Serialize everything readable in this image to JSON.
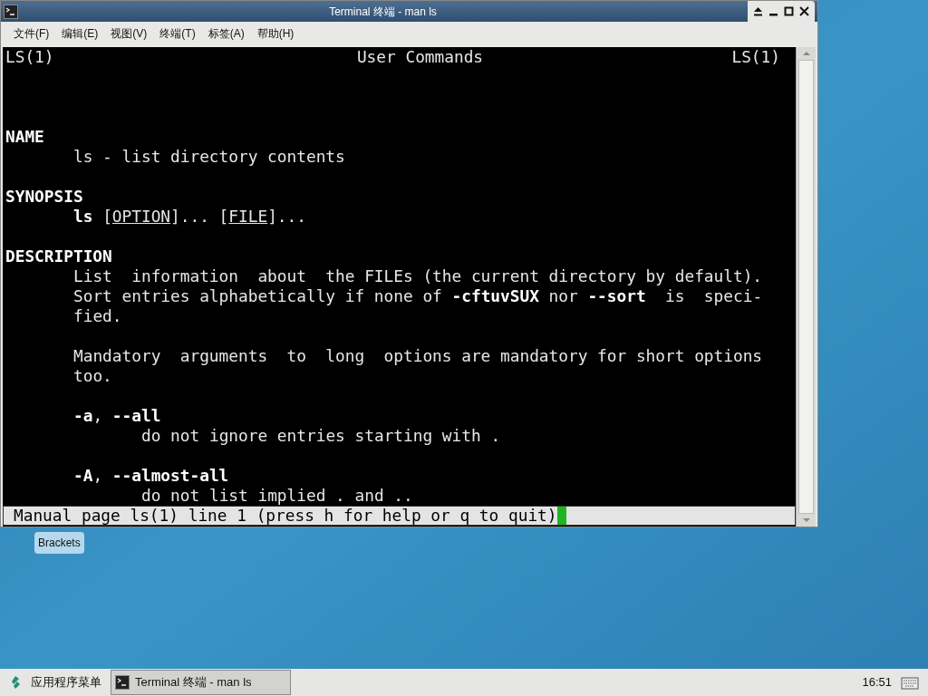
{
  "window": {
    "title": "Terminal 终端 - man ls"
  },
  "menu": [
    "文件(F)",
    "编辑(E)",
    "视图(V)",
    "终端(T)",
    "标签(A)",
    "帮助(H)"
  ],
  "terminal": {
    "header": {
      "left": "LS(1)",
      "center": "User Commands",
      "right": "LS(1)"
    },
    "lines": [
      {
        "kind": "blank"
      },
      {
        "kind": "blank"
      },
      {
        "kind": "blank"
      },
      {
        "kind": "heading",
        "segments": [
          {
            "text": "NAME",
            "kind": "bold"
          }
        ]
      },
      {
        "kind": "body",
        "segments": [
          {
            "text": "ls - list directory contents",
            "kind": "plain"
          }
        ]
      },
      {
        "kind": "blank"
      },
      {
        "kind": "heading",
        "segments": [
          {
            "text": "SYNOPSIS",
            "kind": "bold"
          }
        ]
      },
      {
        "kind": "body",
        "segments": [
          {
            "text": "ls",
            "kind": "bold"
          },
          {
            "text": " [",
            "kind": "plain"
          },
          {
            "text": "OPTION",
            "kind": "underline"
          },
          {
            "text": "]... [",
            "kind": "plain"
          },
          {
            "text": "FILE",
            "kind": "underline"
          },
          {
            "text": "]...",
            "kind": "plain"
          }
        ]
      },
      {
        "kind": "blank"
      },
      {
        "kind": "heading",
        "segments": [
          {
            "text": "DESCRIPTION",
            "kind": "bold"
          }
        ]
      },
      {
        "kind": "body",
        "segments": [
          {
            "text": "List  information  about  the FILEs (the current directory by default).",
            "kind": "plain"
          }
        ]
      },
      {
        "kind": "body",
        "segments": [
          {
            "text": "Sort entries alphabetically if none of ",
            "kind": "plain"
          },
          {
            "text": "-cftuvSUX",
            "kind": "bold"
          },
          {
            "text": " nor ",
            "kind": "plain"
          },
          {
            "text": "--sort",
            "kind": "bold"
          },
          {
            "text": "  is  speci-",
            "kind": "plain"
          }
        ]
      },
      {
        "kind": "body",
        "segments": [
          {
            "text": "fied.",
            "kind": "plain"
          }
        ]
      },
      {
        "kind": "blank"
      },
      {
        "kind": "body",
        "segments": [
          {
            "text": "Mandatory  arguments  to  long  options are mandatory for short options",
            "kind": "plain"
          }
        ]
      },
      {
        "kind": "body",
        "segments": [
          {
            "text": "too.",
            "kind": "plain"
          }
        ]
      },
      {
        "kind": "blank"
      },
      {
        "kind": "body",
        "segments": [
          {
            "text": "-a",
            "kind": "bold"
          },
          {
            "text": ", ",
            "kind": "plain"
          },
          {
            "text": "--all",
            "kind": "bold"
          }
        ]
      },
      {
        "kind": "detail",
        "segments": [
          {
            "text": "do not ignore entries starting with .",
            "kind": "plain"
          }
        ]
      },
      {
        "kind": "blank"
      },
      {
        "kind": "body",
        "segments": [
          {
            "text": "-A",
            "kind": "bold"
          },
          {
            "text": ", ",
            "kind": "plain"
          },
          {
            "text": "--almost-all",
            "kind": "bold"
          }
        ]
      },
      {
        "kind": "detail",
        "segments": [
          {
            "text": "do not list implied . and ..",
            "kind": "plain"
          }
        ]
      }
    ],
    "status": "Manual page ls(1) line 1 (press h for help or q to quit)"
  },
  "desktop_icon": {
    "label": "Brackets"
  },
  "taskbar": {
    "app_menu": "应用程序菜单",
    "tasks": [
      {
        "label": "Terminal 终端 - man ls",
        "selected": true
      }
    ],
    "clock": "16:51"
  }
}
